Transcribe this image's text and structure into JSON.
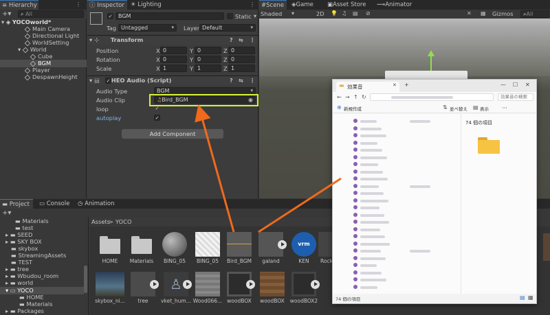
{
  "hierarchy": {
    "tab": "Hierarchy",
    "search_placeholder": "All",
    "scene": "YOCOworld*",
    "items": [
      "Main Camera",
      "Directional Light",
      "WorldSetting",
      "World",
      "Cube",
      "BGM",
      "Player",
      "DespawnHeight"
    ]
  },
  "inspector": {
    "tab": "Inspector",
    "tab2": "Lighting",
    "object_name": "BGM",
    "static_label": "Static",
    "tag_label": "Tag",
    "tag_value": "Untagged",
    "layer_label": "Layer",
    "layer_value": "Default",
    "transform": {
      "title": "Transform",
      "position_label": "Position",
      "rotation_label": "Rotation",
      "scale_label": "Scale",
      "axes": [
        "X",
        "Y",
        "Z"
      ],
      "position": [
        "0",
        "0",
        "0"
      ],
      "rotation": [
        "0",
        "0",
        "0"
      ],
      "scale": [
        "1",
        "1",
        "1"
      ]
    },
    "audio": {
      "title": "HEO Audio (Script)",
      "audio_type_label": "Audio Type",
      "audio_type_value": "BGM",
      "audio_clip_label": "Audio Clip",
      "audio_clip_value": "Bird_BGM",
      "loop_label": "loop",
      "autoplay_label": "autoplay",
      "check": "✓"
    },
    "add_component": "Add Component"
  },
  "scene_view": {
    "tabs": [
      "Scene",
      "Game",
      "Asset Store",
      "Animator"
    ],
    "shading": "Shaded",
    "mode_2d": "2D",
    "gizmos": "Gizmos",
    "search_placeholder": "All"
  },
  "project": {
    "tabs": [
      "Project",
      "Console",
      "Animation"
    ],
    "tree": [
      "Materials",
      "test",
      "SEED",
      "SKY BOX",
      "skybox",
      "StreamingAssets",
      "TEST",
      "tree",
      "Wbudou_room",
      "world",
      "YOCO",
      "HOME",
      "Materials",
      "Packages"
    ],
    "breadcrumb": [
      "Assets",
      "YOCO"
    ],
    "assets_row1": [
      "HOME",
      "Materials",
      "BING_05",
      "BING_05",
      "Bird_BGM",
      "galand",
      "KEN",
      "Rock"
    ],
    "assets_row2": [
      "skybox_ni...",
      "tree",
      "vket_hum...",
      "Wood066...",
      "woodBOX",
      "woodBOX",
      "woodBOX2"
    ],
    "vrm_badge": "vrm"
  },
  "explorer": {
    "title": "効果音",
    "new_tab": "+",
    "new_label": "新規作成",
    "sort_label": "並べ替え",
    "view_label": "表示",
    "more_label": "···",
    "search_placeholder": "効果音の検索",
    "count_header": "74 個の項目",
    "status": "74 個の項目"
  },
  "colors": {
    "highlight": "#d6f13a",
    "arrow": "#f06a1c",
    "accent": "#3a79bb"
  }
}
